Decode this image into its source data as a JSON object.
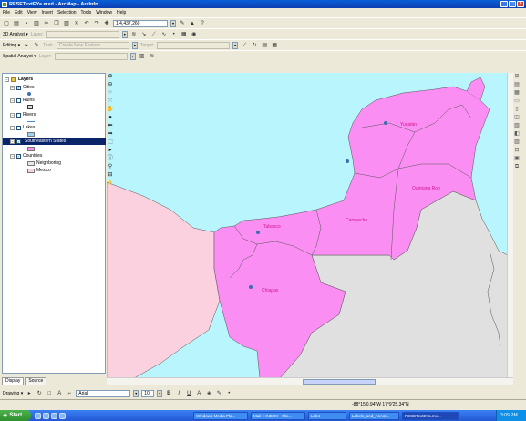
{
  "window": {
    "title": "RESETextEYa.mxd - ArcMap - ArcInfo",
    "controls": [
      "_",
      "□",
      "×"
    ]
  },
  "menu": [
    "File",
    "Edit",
    "View",
    "Insert",
    "Selection",
    "Tools",
    "Window",
    "Help"
  ],
  "toolbar_standard": {
    "scale_value": "1:4,437,260"
  },
  "toolbar_3d": {
    "label": "3D Analyst ▾",
    "layer_label": "Layer:"
  },
  "toolbar_editor": {
    "label": "Editing ▾",
    "task_label": "Task:",
    "task_value": "Create New Feature",
    "target_label": "Target:"
  },
  "toolbar_spatial": {
    "label": "Spatial Analyst ▾",
    "layer_label": "Layer:"
  },
  "toc": {
    "root": "Layers",
    "layers": [
      {
        "name": "Cities",
        "checked": true,
        "expanded": true
      },
      {
        "name": "Ruins",
        "checked": false,
        "expanded": true
      },
      {
        "name": "Rivers",
        "checked": false,
        "expanded": true
      },
      {
        "name": "Lakes",
        "checked": false,
        "expanded": true
      },
      {
        "name": "Southeastern States",
        "checked": true,
        "expanded": true,
        "selected": true
      },
      {
        "name": "Countries",
        "checked": true,
        "expanded": true
      }
    ],
    "legend_countries": [
      {
        "label": "Neighboring",
        "color": "#e8e8e8"
      },
      {
        "label": "Mexico",
        "color": "#fcd1df"
      }
    ],
    "tabs": [
      "Display",
      "Source"
    ]
  },
  "map": {
    "colors": {
      "water": "#b9f5fd",
      "states": "#fb8ef3",
      "mexico": "#fcd1df",
      "neighboring": "#e0e0e0",
      "label": "#d01890",
      "city": "#3a6fb0"
    },
    "labels": {
      "yucatan": "Yucatán",
      "quintana_roo": "Quintana Roo",
      "campeche": "Campeche",
      "tabasco": "Tabasco",
      "chiapas": "Chiapas"
    }
  },
  "drawing": {
    "label": "Drawing ▾",
    "font": "Arial",
    "size": "10"
  },
  "status": {
    "coords": "-88°15'0.94\"W  17°9'25.34\"N"
  },
  "taskbar": {
    "start": "Start",
    "tasks": [
      "Windows Media Pla...",
      "Mail :: INBOX - Mic...",
      "Lab4",
      "Labels_and_Annot...",
      "RESETextEYa.mx..."
    ],
    "clock": "3:09 PM"
  }
}
